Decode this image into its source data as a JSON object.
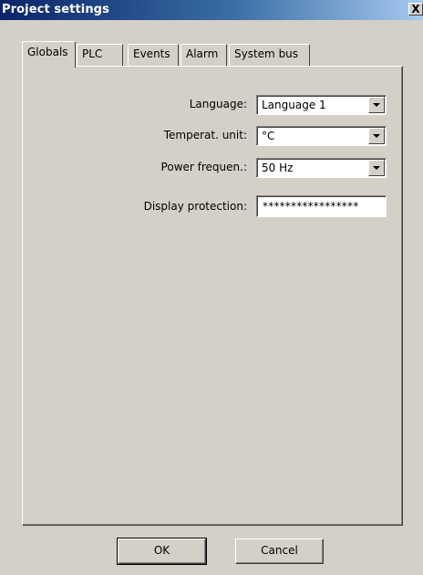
{
  "window": {
    "title": "Project settings",
    "close_glyph": "X"
  },
  "tabs": [
    {
      "label": "Globals",
      "active": true
    },
    {
      "label": "PLC",
      "active": false
    },
    {
      "label": "Events",
      "active": false
    },
    {
      "label": "Alarm",
      "active": false
    },
    {
      "label": "System bus",
      "active": false
    }
  ],
  "globals": {
    "language": {
      "label": "Language:",
      "value": "Language 1"
    },
    "temperature_unit": {
      "label": "Temperat. unit:",
      "value": "°C"
    },
    "power_frequency": {
      "label": "Power frequen.:",
      "value": "50 Hz"
    },
    "display_protection": {
      "label": "Display protection:",
      "value": "*****************"
    }
  },
  "buttons": {
    "ok": "OK",
    "cancel": "Cancel"
  },
  "colors": {
    "dialog_face": "#d4d0c8",
    "titlebar_start": "#0a246a",
    "titlebar_end": "#a6caf0",
    "titlebar_text": "#ffffff"
  },
  "icons": {
    "close": "close-icon",
    "dropdown": "chevron-down-icon"
  }
}
